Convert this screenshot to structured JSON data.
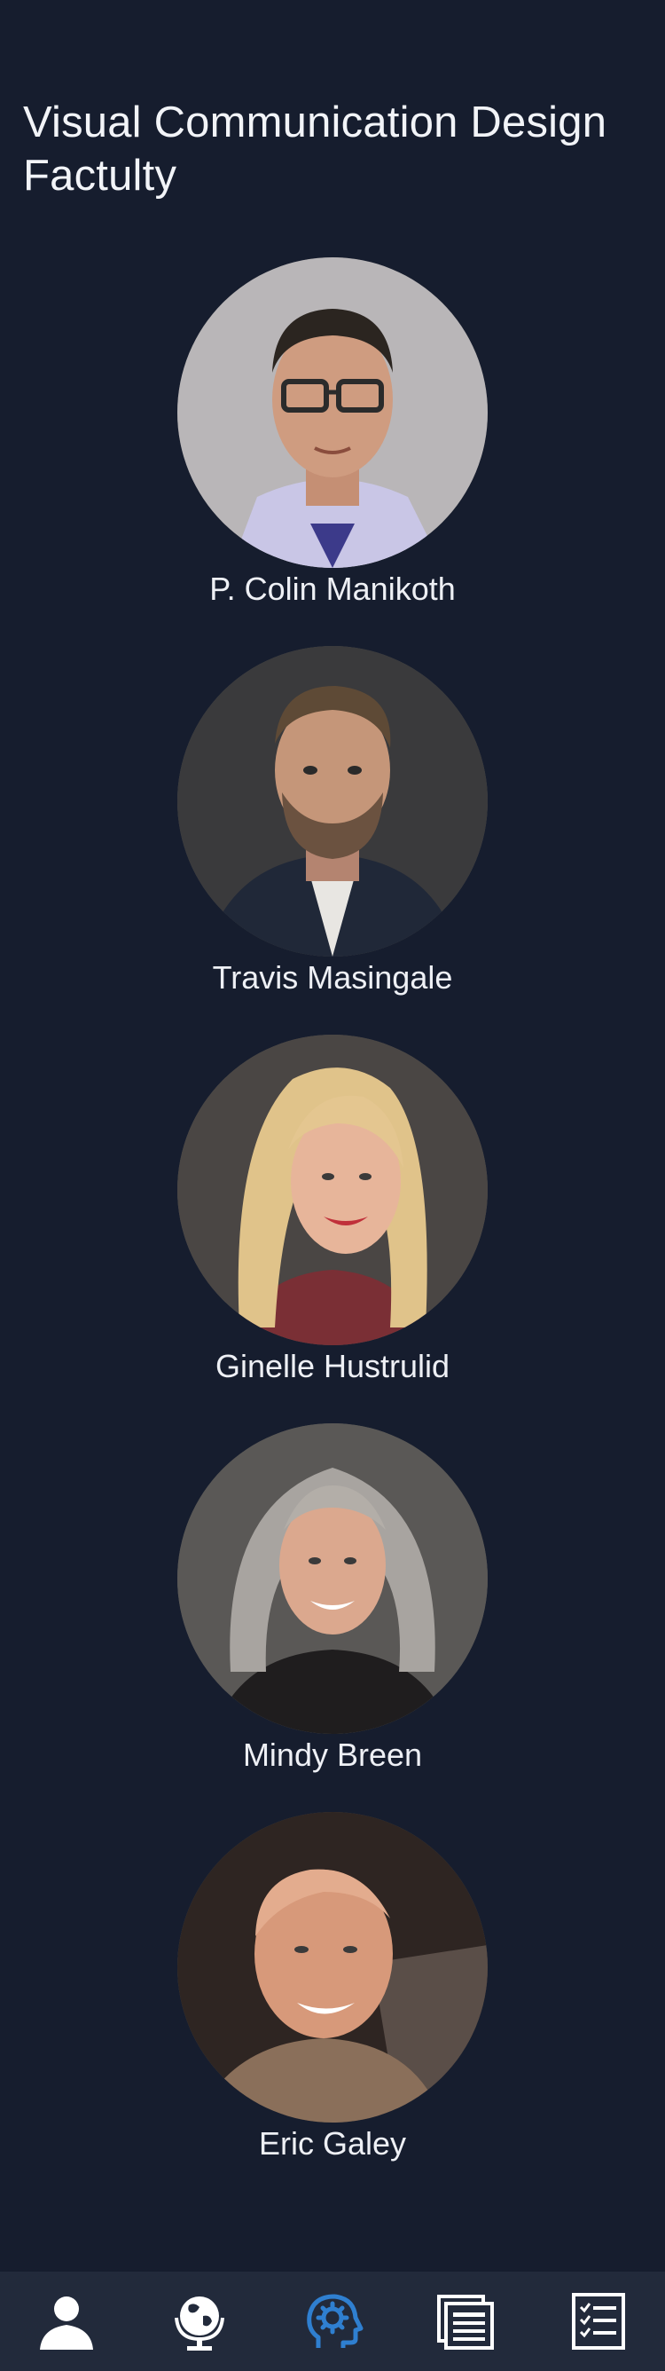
{
  "page": {
    "title": "Visual Communication Design Factulty"
  },
  "faculty": [
    {
      "name": "P. Colin Manikoth"
    },
    {
      "name": "Travis Masingale"
    },
    {
      "name": "Ginelle Hustrulid"
    },
    {
      "name": "Mindy Breen"
    },
    {
      "name": "Eric Galey"
    }
  ],
  "nav": {
    "items": [
      {
        "icon": "user-icon",
        "active": false
      },
      {
        "icon": "globe-icon",
        "active": false
      },
      {
        "icon": "head-gear-icon",
        "active": true
      },
      {
        "icon": "documents-icon",
        "active": false
      },
      {
        "icon": "checklist-icon",
        "active": false
      }
    ],
    "colors": {
      "default": "#ffffff",
      "active": "#2f7fd0"
    }
  }
}
